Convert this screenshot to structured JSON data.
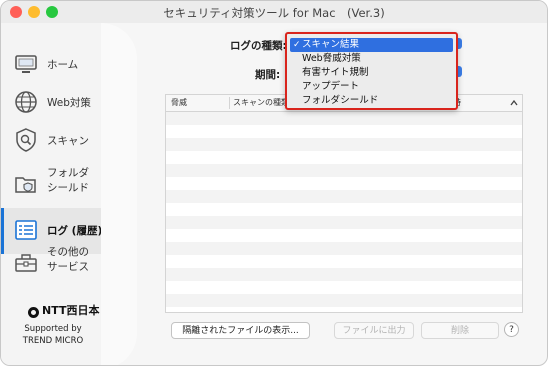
{
  "window": {
    "title": "セキュリティ対策ツール for Mac　(Ver.3)"
  },
  "sidebar": {
    "items": [
      {
        "label": "ホーム",
        "icon": "monitor-icon"
      },
      {
        "label": "Web対策",
        "icon": "globe-icon"
      },
      {
        "label": "スキャン",
        "icon": "shield-search-icon"
      },
      {
        "label": "フォルダ\nシールド",
        "icon": "folder-shield-icon"
      },
      {
        "label": "ログ (履歴)",
        "icon": "log-icon",
        "active": true
      },
      {
        "label": "その他の\nサービス",
        "icon": "toolbox-icon"
      }
    ],
    "logo_text": "NTT西日本",
    "supported_line1": "Supported by",
    "supported_line2": "TREND MICRO"
  },
  "filters": {
    "log_type_label": "ログの種類:",
    "period_label": "期間:"
  },
  "log_type_dropdown": {
    "selected": "スキャン結果",
    "options": [
      "スキャン結果",
      "Web脅威対策",
      "有害サイト規制",
      "アップデート",
      "フォルダシールド"
    ]
  },
  "table": {
    "columns": [
      "脅威",
      "スキャンの種類",
      "時"
    ]
  },
  "buttons": {
    "show_quarantined": "隔離されたファイルの表示...",
    "export_file": "ファイルに出力",
    "delete": "削除",
    "help": "?"
  },
  "colors": {
    "accent": "#2f6fe0",
    "highlight_border": "#d9241c"
  }
}
